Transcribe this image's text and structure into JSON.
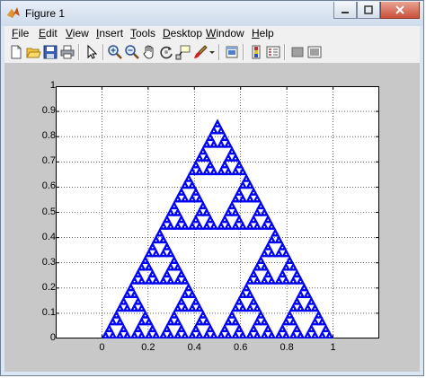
{
  "window": {
    "title": "Figure 1"
  },
  "menu": [
    {
      "key": "F",
      "rest": "ile"
    },
    {
      "key": "E",
      "rest": "dit"
    },
    {
      "key": "V",
      "rest": "iew"
    },
    {
      "key": "I",
      "rest": "nsert"
    },
    {
      "key": "T",
      "rest": "ools"
    },
    {
      "key": "D",
      "rest": "esktop"
    },
    {
      "key": "W",
      "rest": "indow"
    },
    {
      "key": "H",
      "rest": "elp"
    }
  ],
  "menu_labels": [
    "File",
    "Edit",
    "View",
    "Insert",
    "Tools",
    "Desktop",
    "Window",
    "Help"
  ],
  "toolbar_icons": [
    "new-figure-icon",
    "open-file-icon",
    "save-icon",
    "print-icon",
    "edit-plot-arrow-icon",
    "zoom-in-icon",
    "zoom-out-icon",
    "pan-hand-icon",
    "rotate-3d-icon",
    "data-cursor-icon",
    "brush-icon",
    "brush-dropdown-icon",
    "link-plot-icon",
    "insert-colorbar-icon",
    "insert-legend-icon",
    "hide-plot-tools-icon",
    "show-plot-tools-icon"
  ],
  "colors": {
    "series": "#0000ff",
    "figure_bg": "#c8c8c8"
  },
  "chart_data": {
    "type": "scatter",
    "title": "",
    "xlabel": "",
    "ylabel": "",
    "xlim": [
      -0.2,
      1.2
    ],
    "ylim": [
      0,
      1
    ],
    "xticks": [
      "0",
      "0.2",
      "0.4",
      "0.6",
      "0.8",
      "1"
    ],
    "xtick_values": [
      0,
      0.2,
      0.4,
      0.6,
      0.8,
      1
    ],
    "yticks": [
      "0",
      "0.1",
      "0.2",
      "0.3",
      "0.4",
      "0.5",
      "0.6",
      "0.7",
      "0.8",
      "0.9",
      "1"
    ],
    "ytick_values": [
      0,
      0.1,
      0.2,
      0.3,
      0.4,
      0.5,
      0.6,
      0.7,
      0.8,
      0.9,
      1
    ],
    "grid": true,
    "series": [
      {
        "marker": "triangle",
        "color": "#0000ff",
        "shape": "sierpinski-triangle",
        "vertices": [
          [
            0,
            0
          ],
          [
            1,
            0
          ],
          [
            0.5,
            0.866
          ]
        ]
      }
    ]
  }
}
